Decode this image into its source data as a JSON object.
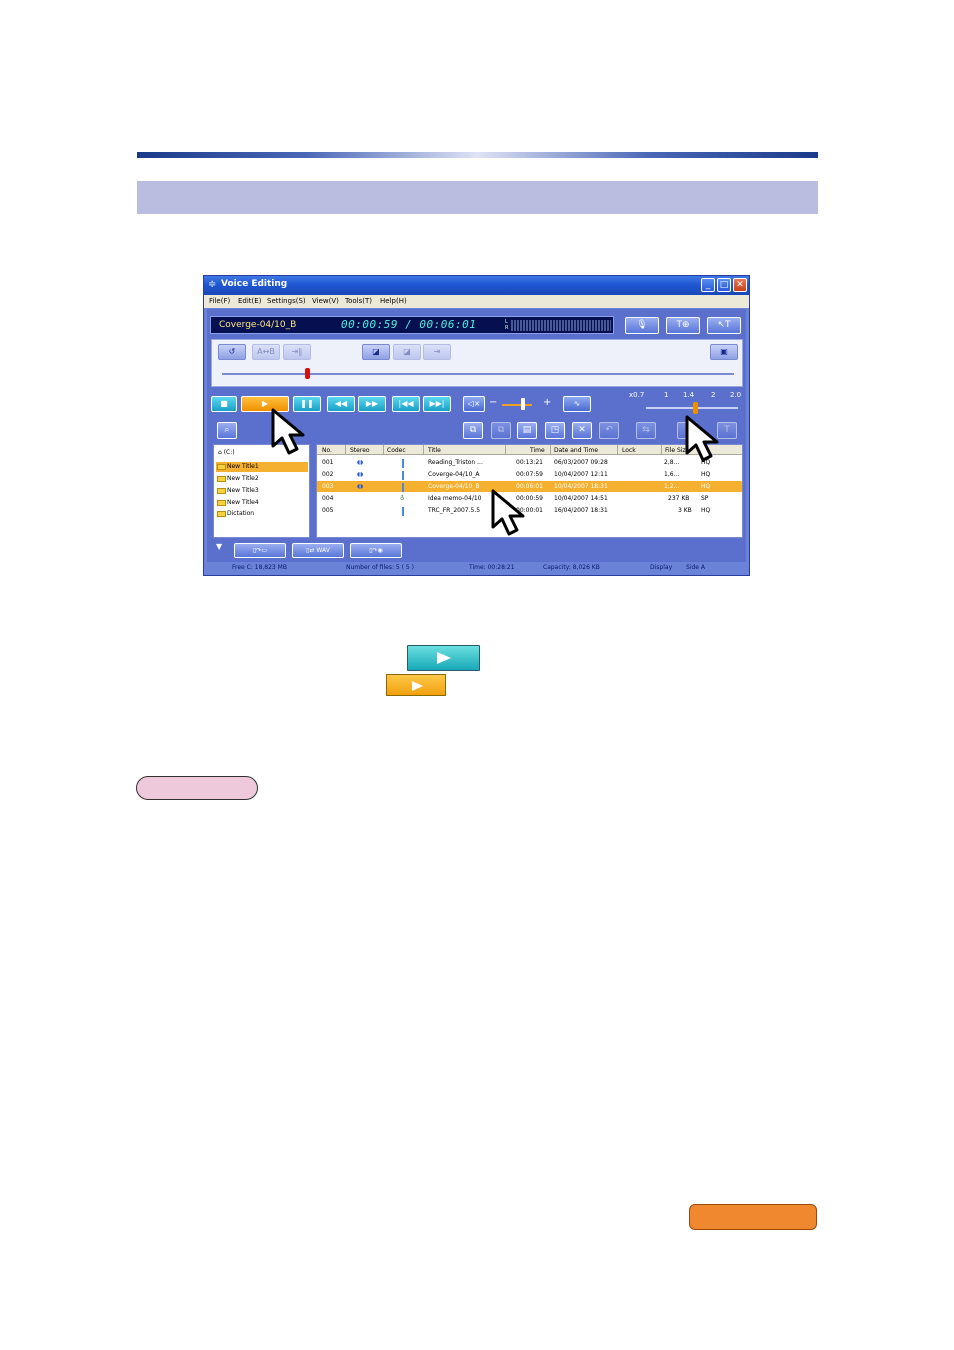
{
  "window": {
    "title": "Voice Editing",
    "menu": [
      "File(F)",
      "Edit(E)",
      "Settings(S)",
      "View(V)",
      "Tools(T)",
      "Help(H)"
    ]
  },
  "lcd": {
    "file_name": "Coverge-04/10_B",
    "counter": "00:00:59 / 00:06:01",
    "meter_l": "L",
    "meter_r": "R"
  },
  "speed": {
    "labels": [
      "x0.7",
      "1",
      "1.4",
      "2",
      "2.0"
    ],
    "value": 1.4
  },
  "tree": {
    "drive": "(C:)",
    "items": [
      "New Title1",
      "New Title2",
      "New Title3",
      "New Title4",
      "Dictation"
    ],
    "selected_index": 0
  },
  "list": {
    "headers": [
      "No.",
      "Stereo",
      "Codec",
      "Title",
      "Time",
      "Date and Time",
      "Lock",
      "File Size"
    ],
    "rows": [
      {
        "no": "001",
        "title": "Reading_Triston ...",
        "time": "00:13:21",
        "date": "06/03/2007 09:28",
        "size": "2,8...",
        "mode": "HQ",
        "stereo": true
      },
      {
        "no": "002",
        "title": "Coverge-04/10_A",
        "time": "00:07:59",
        "date": "10/04/2007 12:11",
        "size": "1,6...",
        "mode": "HQ",
        "stereo": true
      },
      {
        "no": "003",
        "title": "Coverge-04/10_B",
        "time": "00:06:01",
        "date": "10/04/2007 18:31",
        "size": "1,2...",
        "mode": "HQ",
        "stereo": true
      },
      {
        "no": "004",
        "title": "Idea memo-04/10",
        "time": "00:00:59",
        "date": "10/04/2007 14:51",
        "size": "237 KB",
        "mode": "SP",
        "stereo": false
      },
      {
        "no": "005",
        "title": "TRC_FR_2007.5.5",
        "time": "00:00:01",
        "date": "16/04/2007 18:31",
        "size": "3 KB",
        "mode": "HQ",
        "stereo": false
      }
    ],
    "selected_index": 2
  },
  "bottom": {
    "wav_label": "WAV"
  },
  "status": {
    "free": "Free C: 18,823 MB",
    "files": "Number of files: 5 ( 5 )",
    "time": "Time: 00:28:21",
    "capacity": "Capacity: 8,026 KB",
    "display_label": "Display",
    "display_value": "Side A"
  },
  "colors": {
    "accent_blue": "#1a3a8a",
    "band": "#babce0",
    "play_orange": "#f0a010",
    "play_teal": "#18a8b8",
    "note_pink": "#eec9dc",
    "orange_pill": "#f08830"
  }
}
